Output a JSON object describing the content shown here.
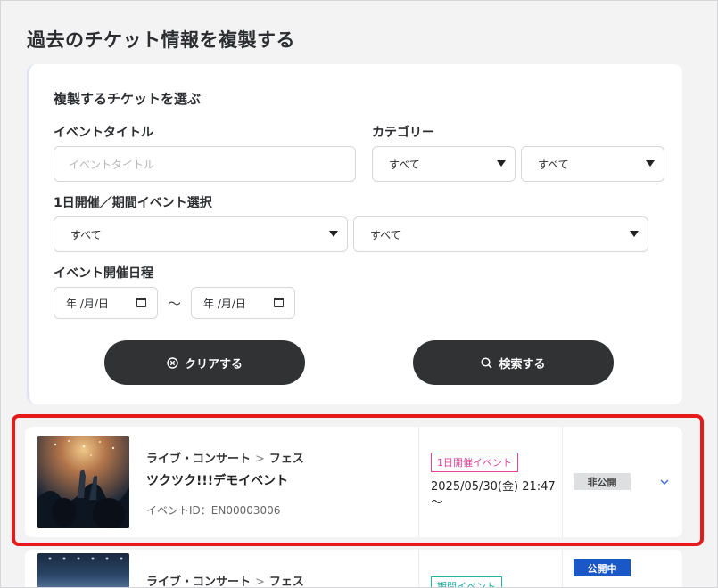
{
  "page_title": "過去のチケット情報を複製する",
  "search": {
    "title": "複製するチケットを選ぶ",
    "event_title_label": "イベントタイトル",
    "event_title_placeholder": "イベントタイトル",
    "category_label": "カテゴリー",
    "category_main": "すべて",
    "category_sub": "すべて",
    "type_label": "1日開催／期間イベント選択",
    "type_value1": "すべて",
    "type_value2": "すべて",
    "date_label": "イベント開催日程",
    "date_from": "年 /月/日",
    "date_to": "年 /月/日",
    "tilde": "〜",
    "clear_button": "クリアする",
    "search_button": "検索する"
  },
  "results": [
    {
      "category": "ライブ・コンサート",
      "subcategory": "フェス",
      "name": "ツクツク!!!デモイベント",
      "event_id": "イベントID：EN00003006",
      "tag": "1日開催イベント",
      "date": "2025/05/30(金) 21:47 〜",
      "status": "非公開"
    },
    {
      "category": "ライブ・コンサート",
      "subcategory": "フェス",
      "tag": "期間イベント",
      "status": "公開中"
    }
  ],
  "colors": {
    "highlight": "#e51b1b",
    "button_bg": "#303234",
    "tag_pink": "#e3439b",
    "tag_teal": "#23b0a6",
    "status_public": "#1a57c7"
  }
}
